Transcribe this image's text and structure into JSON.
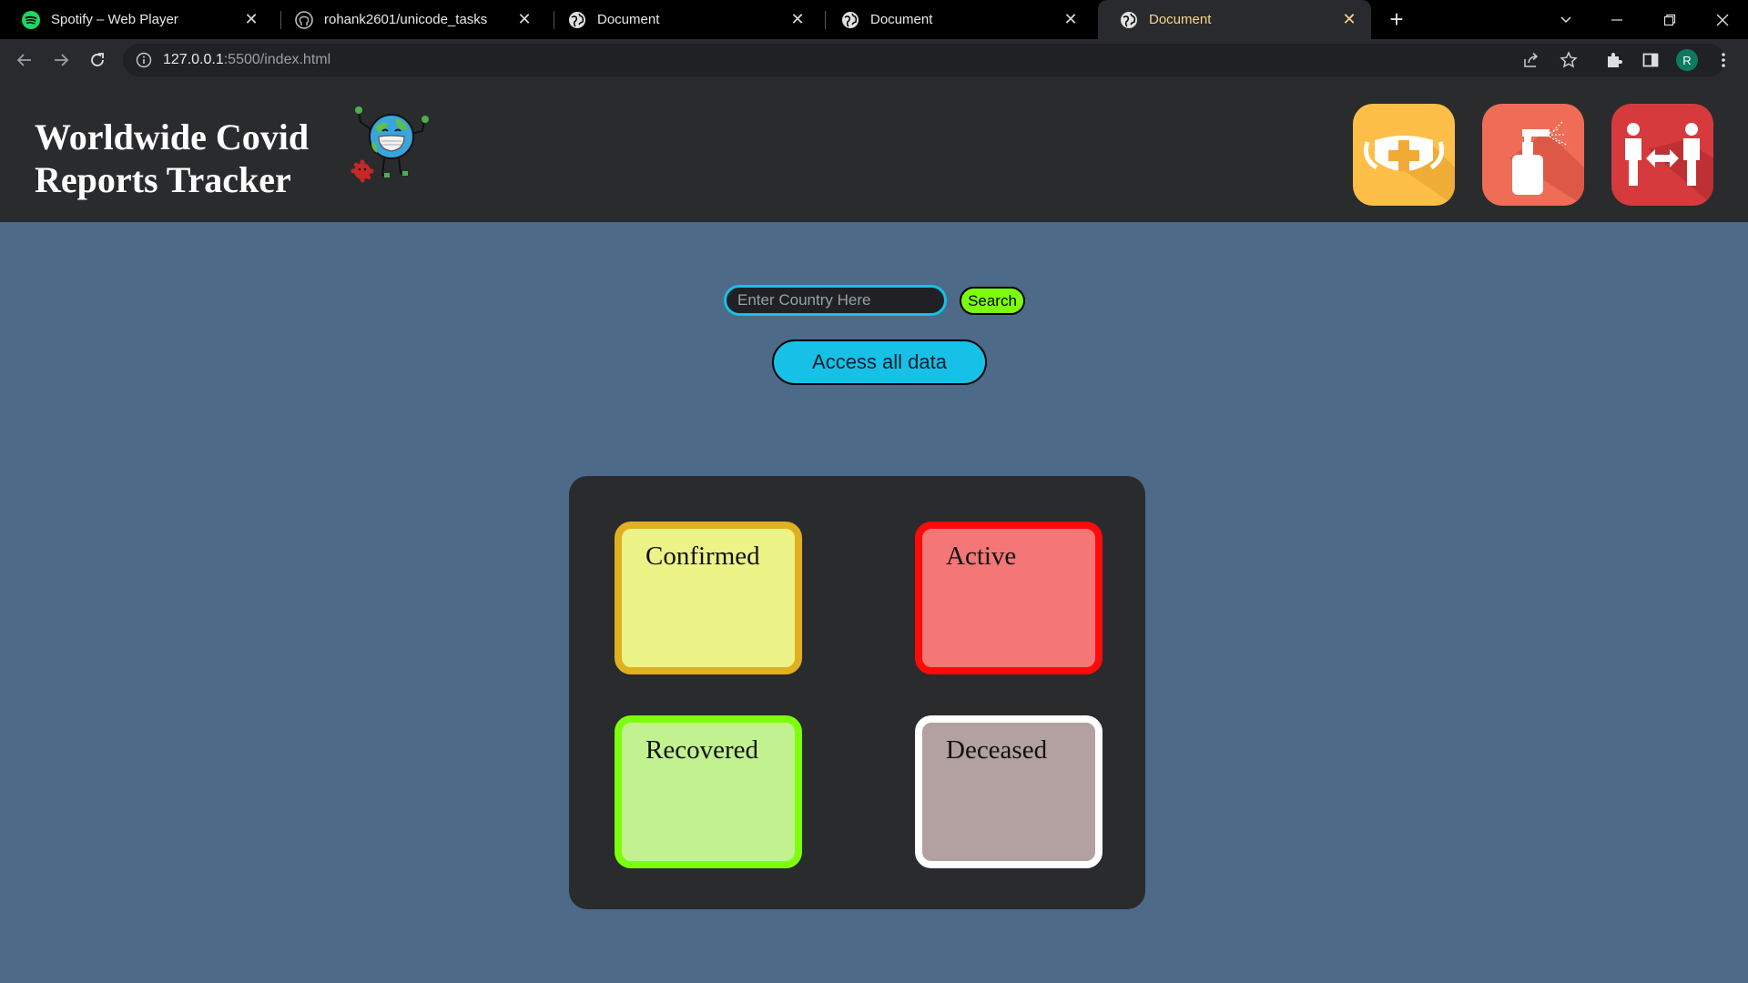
{
  "browser": {
    "tabs": [
      {
        "title": "Spotify – Web Player",
        "favicon": "spotify-icon"
      },
      {
        "title": "rohank2601/unicode_tasks",
        "favicon": "github-icon"
      },
      {
        "title": "Document",
        "favicon": "globe-icon"
      },
      {
        "title": "Document",
        "favicon": "globe-icon"
      },
      {
        "title": "Document",
        "favicon": "globe-icon",
        "active": true
      }
    ],
    "url_host": "127.0.0.1",
    "url_path": ":5500/index.html",
    "profile_initial": "R"
  },
  "header": {
    "title_line1": "Worldwide Covid",
    "title_line2": "Reports Tracker",
    "icons": [
      "face-mask-icon",
      "hand-sanitizer-icon",
      "social-distancing-icon"
    ]
  },
  "search": {
    "placeholder": "Enter Country Here",
    "button_label": "Search",
    "access_all_label": "Access all data"
  },
  "stats": {
    "confirmed": "Confirmed",
    "active": "Active",
    "recovered": "Recovered",
    "deceased": "Deceased"
  },
  "colors": {
    "page_bg": "#4d6a88",
    "header_bg": "#2a2b2d",
    "accent_cyan": "#17c0e6",
    "accent_green": "#7cff0d",
    "confirmed_border": "#e0b020",
    "confirmed_fill": "#ecf387",
    "active_border": "#ff0a0a",
    "active_fill": "#f47676",
    "recovered_border": "#7cff0d",
    "recovered_fill": "#c2f190",
    "deceased_border": "#ffffff",
    "deceased_fill": "#b3a0a0"
  }
}
